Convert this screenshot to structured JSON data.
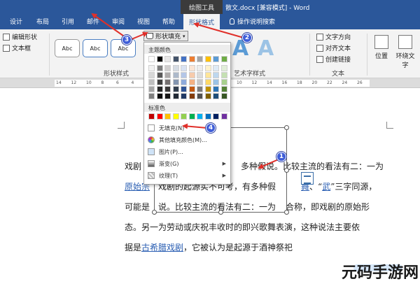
{
  "title_bar": {
    "context_tab": "绘图工具",
    "doc_title": "散文.docx [兼容模式] - Word"
  },
  "tabs": [
    {
      "label": "设计"
    },
    {
      "label": "布局"
    },
    {
      "label": "引用"
    },
    {
      "label": "邮件"
    },
    {
      "label": "审阅"
    },
    {
      "label": "视图"
    },
    {
      "label": "帮助"
    },
    {
      "label": "形状格式"
    },
    {
      "label": "操作说明搜索"
    }
  ],
  "ribbon": {
    "edit_shape": "编辑形状",
    "text_box": "文本框",
    "style_sample": "Abc",
    "shape_fill": "形状填充",
    "shape_styles_label": "形状样式",
    "art_styles_label": "艺术字样式",
    "text_direction": "文字方向",
    "align_text": "对齐文本",
    "create_link": "创建链接",
    "text_group_label": "文本",
    "position": "位置",
    "wrap_text": "环绕文字"
  },
  "ruler_ticks": [
    "14",
    "12",
    "10",
    "8",
    "6",
    "4",
    "2",
    "",
    "2",
    "4",
    "6",
    "8",
    "10",
    "12",
    "14",
    "16",
    "18",
    "20",
    "22",
    "24",
    "26"
  ],
  "dropdown": {
    "theme_colors_label": "主题颜色",
    "standard_colors_label": "标准色",
    "no_fill": "无填充(N)",
    "more_colors": "其他填充颜色(M)...",
    "picture": "图片(P)...",
    "gradient": "渐变(G)",
    "texture": "纹理(T)",
    "theme_top": [
      "#ffffff",
      "#000000",
      "#e7e6e6",
      "#44546a",
      "#4472c4",
      "#ed7d31",
      "#a5a5a5",
      "#ffc000",
      "#5b9bd5",
      "#70ad47"
    ],
    "theme_shades": [
      [
        "#f2f2f2",
        "#7f7f7f",
        "#d0cece",
        "#d6dce4",
        "#d9e2f3",
        "#fbe5d5",
        "#ededed",
        "#fff2cc",
        "#deebf6",
        "#e2efd9"
      ],
      [
        "#d8d8d8",
        "#595959",
        "#aeabab",
        "#adb9ca",
        "#b4c6e7",
        "#f7cbac",
        "#dbdbdb",
        "#fee599",
        "#bdd7ee",
        "#c5e0b3"
      ],
      [
        "#bfbfbf",
        "#3f3f3f",
        "#757070",
        "#8496b0",
        "#8eaadb",
        "#f4b183",
        "#c9c9c9",
        "#ffd965",
        "#9cc3e5",
        "#a8d08d"
      ],
      [
        "#a5a5a5",
        "#262626",
        "#3a3838",
        "#323f4f",
        "#2f5496",
        "#c55a11",
        "#7b7b7b",
        "#bf9000",
        "#2e75b5",
        "#538135"
      ],
      [
        "#7f7f7f",
        "#0c0c0c",
        "#171616",
        "#222a35",
        "#1f3864",
        "#833c0b",
        "#525252",
        "#7f6000",
        "#1e4e79",
        "#375623"
      ]
    ],
    "standard": [
      "#c00000",
      "#ff0000",
      "#ffc000",
      "#ffff00",
      "#92d050",
      "#00b050",
      "#00b0f0",
      "#0070c0",
      "#002060",
      "#7030a0"
    ]
  },
  "document": {
    "line1_a": "戏剧",
    "line1_b": "多种假说。比较主流的看法有二：一为",
    "line2_link": "原始宗",
    "line2_a": "戏剧的起源实不可考，有多种假",
    "line2_b": "舞",
    "line2_c": "、“",
    "line2_link2": "武",
    "line2_d": "”三字同源，",
    "line3_a": "可能是",
    "line3_b": "说。比较主流的看法有二：一为",
    "line3_c": "合称，即戏剧的原始形",
    "line4": "态。另一为劳动或庆祝丰收时的即兴歌舞表演，这种说法主要依",
    "line5_a": "据是",
    "line5_link": "古希腊戏剧",
    "line5_b": "，它被认为是起源于酒神祭祀"
  },
  "badges": [
    "1",
    "2",
    "3",
    "4"
  ],
  "watermark": "元码手游网"
}
